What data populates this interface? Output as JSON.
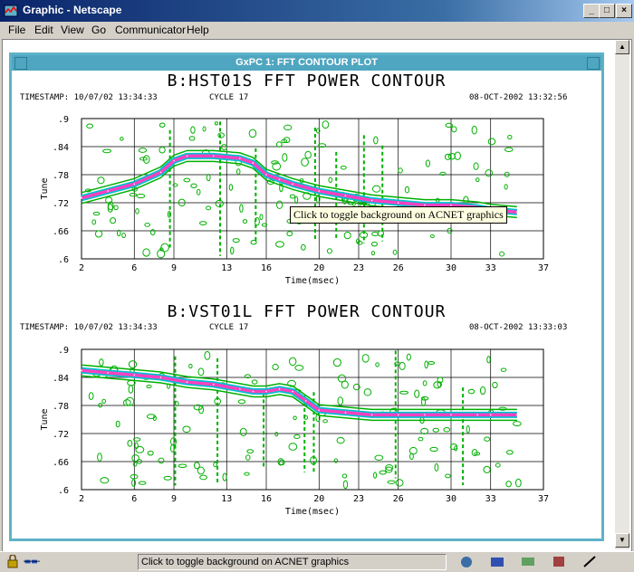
{
  "window": {
    "title": "Graphic - Netscape"
  },
  "menu": [
    {
      "label": "File"
    },
    {
      "label": "Edit"
    },
    {
      "label": "View"
    },
    {
      "label": "Go"
    },
    {
      "label": "Communicator"
    },
    {
      "label": "Help"
    }
  ],
  "subwindow": {
    "title": "GxPC 1: FFT CONTOUR PLOT"
  },
  "tooltip": "Click to toggle background on ACNET graphics",
  "status": {
    "text": "Click to toggle background on ACNET graphics"
  },
  "colors": {
    "contour_green": "#00b000",
    "contour_pink": "#ff40c0",
    "contour_cyan": "#00c0d0",
    "window_border": "#5eb2c9"
  },
  "plots": [
    {
      "title": "B:HST01S FFT POWER CONTOUR",
      "timestamp": "TIMESTAMP: 10/07/02 13:34:33",
      "cycle": "CYCLE 17",
      "date": "08-OCT-2002 13:32:56",
      "xlabel": "Time(msec)",
      "ylabel": "Tune"
    },
    {
      "title": "B:VST01L FFT POWER CONTOUR",
      "timestamp": "TIMESTAMP: 10/07/02 13:34:33",
      "cycle": "CYCLE 17",
      "date": "08-OCT-2002 13:33:03",
      "xlabel": "Time(msec)",
      "ylabel": "Tune"
    }
  ],
  "chart_data": [
    {
      "type": "line",
      "title": "B:HST01S FFT POWER CONTOUR",
      "xlabel": "Time(msec)",
      "ylabel": "Tune",
      "xlim": [
        2,
        37
      ],
      "ylim": [
        0.6,
        0.9
      ],
      "xticks": [
        "2",
        "6",
        "9",
        "13",
        "16",
        "20",
        "23",
        "26",
        "30",
        "33",
        "37"
      ],
      "yticks": [
        ".6",
        ".66",
        ".72",
        ".78",
        ".84",
        ".9"
      ],
      "grid": true,
      "series": [
        {
          "x": [
            2,
            4,
            6,
            8,
            9,
            10,
            12,
            14,
            15,
            16,
            17,
            18,
            20,
            22,
            24,
            26,
            28,
            30,
            32,
            33,
            35
          ],
          "y": [
            0.73,
            0.745,
            0.76,
            0.785,
            0.81,
            0.82,
            0.82,
            0.815,
            0.805,
            0.78,
            0.77,
            0.76,
            0.745,
            0.735,
            0.725,
            0.72,
            0.715,
            0.715,
            0.71,
            0.705,
            0.7
          ]
        }
      ]
    },
    {
      "type": "line",
      "title": "B:VST01L FFT POWER CONTOUR",
      "xlabel": "Time(msec)",
      "ylabel": "Tune",
      "xlim": [
        2,
        37
      ],
      "ylim": [
        0.6,
        0.9
      ],
      "xticks": [
        "2",
        "6",
        "9",
        "13",
        "16",
        "20",
        "23",
        "26",
        "30",
        "33",
        "37"
      ],
      "yticks": [
        ".6",
        ".66",
        ".72",
        ".78",
        ".84",
        ".9"
      ],
      "grid": true,
      "series": [
        {
          "x": [
            2,
            4,
            6,
            8,
            10,
            12,
            14,
            15,
            16,
            17,
            18,
            19,
            20,
            22,
            24,
            26,
            28,
            30,
            32,
            33,
            35
          ],
          "y": [
            0.855,
            0.85,
            0.845,
            0.84,
            0.83,
            0.825,
            0.815,
            0.81,
            0.81,
            0.815,
            0.81,
            0.79,
            0.77,
            0.765,
            0.76,
            0.76,
            0.76,
            0.76,
            0.76,
            0.76,
            0.76
          ]
        }
      ]
    }
  ]
}
